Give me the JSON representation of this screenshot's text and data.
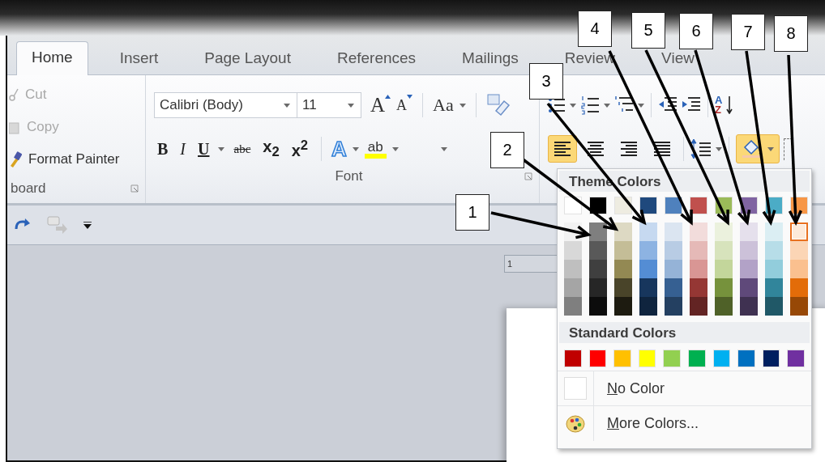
{
  "tabs": [
    {
      "label": "Home",
      "selected": true
    },
    {
      "label": "Insert",
      "selected": false
    },
    {
      "label": "Page Layout",
      "selected": false
    },
    {
      "label": "References",
      "selected": false
    },
    {
      "label": "Mailings",
      "selected": false
    },
    {
      "label": "Review",
      "selected": false
    },
    {
      "label": "View",
      "selected": false
    }
  ],
  "clipboard": {
    "items": [
      {
        "kind": "cut",
        "label": "Cut",
        "disabled": true
      },
      {
        "kind": "copy",
        "label": "Copy",
        "disabled": true
      },
      {
        "kind": "painter",
        "label": "Format Painter",
        "disabled": false
      }
    ],
    "group_label": "board"
  },
  "font": {
    "font_name": "Calibri (Body)",
    "font_size": "11",
    "grow_font": "A",
    "shrink_font": "A",
    "change_case": "Aa",
    "format_buttons": [
      {
        "kind": "bold",
        "label": "B"
      },
      {
        "kind": "italic",
        "label": "I"
      },
      {
        "kind": "underline",
        "label": "U"
      },
      {
        "kind": "strike",
        "label": "abc"
      },
      {
        "kind": "script",
        "label": "x$_{2}$"
      },
      {
        "kind": "script",
        "label": "x$^{2}$"
      }
    ],
    "text_effects": "A",
    "highlight": "ab",
    "group_label": "Font"
  },
  "paragraph": {
    "alignments": [
      {
        "kind": "left",
        "selected": true
      },
      {
        "kind": "center",
        "selected": false
      },
      {
        "kind": "right",
        "selected": false
      },
      {
        "kind": "justify",
        "selected": false
      }
    ],
    "sort": {
      "top": "A",
      "bottom": "Z"
    },
    "shading_button": {
      "selected": true
    }
  },
  "quick_access": {
    "repeat_button": {
      "disabled": true
    }
  },
  "ruler": {
    "text": "1"
  },
  "color_menu": {
    "theme_title": "Theme Colors",
    "theme_columns": [
      {
        "swatches": [
          {
            "color": "#ffffff",
            "selected": false
          },
          {
            "color": "#f2f2f2",
            "selected": false
          },
          {
            "color": "#d8d8d8",
            "selected": false
          },
          {
            "color": "#bfbfbf",
            "selected": false
          },
          {
            "color": "#a5a5a5",
            "selected": false
          },
          {
            "color": "#7f7f7f",
            "selected": false
          }
        ]
      },
      {
        "swatches": [
          {
            "color": "#000000",
            "selected": false
          },
          {
            "color": "#7f7f7f",
            "selected": false
          },
          {
            "color": "#595959",
            "selected": false
          },
          {
            "color": "#3f3f3f",
            "selected": false
          },
          {
            "color": "#262626",
            "selected": false
          },
          {
            "color": "#0c0c0c",
            "selected": false
          }
        ]
      },
      {
        "swatches": [
          {
            "color": "#eeece1",
            "selected": false
          },
          {
            "color": "#ddd9c3",
            "selected": false
          },
          {
            "color": "#c4bd97",
            "selected": false
          },
          {
            "color": "#938953",
            "selected": false
          },
          {
            "color": "#494429",
            "selected": false
          },
          {
            "color": "#1d1b10",
            "selected": false
          }
        ]
      },
      {
        "swatches": [
          {
            "color": "#1f497d",
            "selected": false
          },
          {
            "color": "#c6d9f0",
            "selected": false
          },
          {
            "color": "#8db3e2",
            "selected": false
          },
          {
            "color": "#548dd4",
            "selected": false
          },
          {
            "color": "#17365d",
            "selected": false
          },
          {
            "color": "#0f243e",
            "selected": false
          }
        ]
      },
      {
        "swatches": [
          {
            "color": "#4f81bd",
            "selected": false
          },
          {
            "color": "#dbe5f1",
            "selected": false
          },
          {
            "color": "#b8cce4",
            "selected": false
          },
          {
            "color": "#95b3d7",
            "selected": false
          },
          {
            "color": "#366092",
            "selected": false
          },
          {
            "color": "#244061",
            "selected": false
          }
        ]
      },
      {
        "swatches": [
          {
            "color": "#c0504d",
            "selected": false
          },
          {
            "color": "#f2dcdb",
            "selected": false
          },
          {
            "color": "#e5b9b7",
            "selected": false
          },
          {
            "color": "#d99694",
            "selected": false
          },
          {
            "color": "#953734",
            "selected": false
          },
          {
            "color": "#632423",
            "selected": false
          }
        ]
      },
      {
        "swatches": [
          {
            "color": "#9bbb59",
            "selected": false
          },
          {
            "color": "#ebf1dd",
            "selected": false
          },
          {
            "color": "#d7e3bc",
            "selected": false
          },
          {
            "color": "#c3d69b",
            "selected": false
          },
          {
            "color": "#76923c",
            "selected": false
          },
          {
            "color": "#4f6128",
            "selected": false
          }
        ]
      },
      {
        "swatches": [
          {
            "color": "#8064a2",
            "selected": false
          },
          {
            "color": "#e5e0ec",
            "selected": false
          },
          {
            "color": "#ccc1d9",
            "selected": false
          },
          {
            "color": "#b2a2c7",
            "selected": false
          },
          {
            "color": "#5f497a",
            "selected": false
          },
          {
            "color": "#3f3151",
            "selected": false
          }
        ]
      },
      {
        "swatches": [
          {
            "color": "#4bacc6",
            "selected": false
          },
          {
            "color": "#dbeef3",
            "selected": false
          },
          {
            "color": "#b7dde8",
            "selected": false
          },
          {
            "color": "#92cddc",
            "selected": false
          },
          {
            "color": "#31859b",
            "selected": false
          },
          {
            "color": "#205867",
            "selected": false
          }
        ]
      },
      {
        "swatches": [
          {
            "color": "#f79646",
            "selected": false
          },
          {
            "color": "#fdeada",
            "selected": true
          },
          {
            "color": "#fbd5b5",
            "selected": false
          },
          {
            "color": "#fac08f",
            "selected": false
          },
          {
            "color": "#e36c09",
            "selected": false
          },
          {
            "color": "#974806",
            "selected": false
          }
        ]
      }
    ],
    "standard_title": "Standard Colors",
    "standard_colors": [
      {
        "color": "#c00000",
        "selected": false
      },
      {
        "color": "#ff0000",
        "selected": false
      },
      {
        "color": "#ffc000",
        "selected": false
      },
      {
        "color": "#ffff00",
        "selected": false
      },
      {
        "color": "#92d050",
        "selected": false
      },
      {
        "color": "#00b050",
        "selected": false
      },
      {
        "color": "#00b0f0",
        "selected": false
      },
      {
        "color": "#0070c0",
        "selected": false
      },
      {
        "color": "#002060",
        "selected": false
      },
      {
        "color": "#7030a0",
        "selected": false
      }
    ],
    "no_color": "No Color",
    "more_colors": "More Colors..."
  },
  "callouts": [
    {
      "label": "1"
    },
    {
      "label": "2"
    },
    {
      "label": "3"
    },
    {
      "label": "4"
    },
    {
      "label": "5"
    },
    {
      "label": "6"
    },
    {
      "label": "7"
    },
    {
      "label": "8"
    }
  ]
}
